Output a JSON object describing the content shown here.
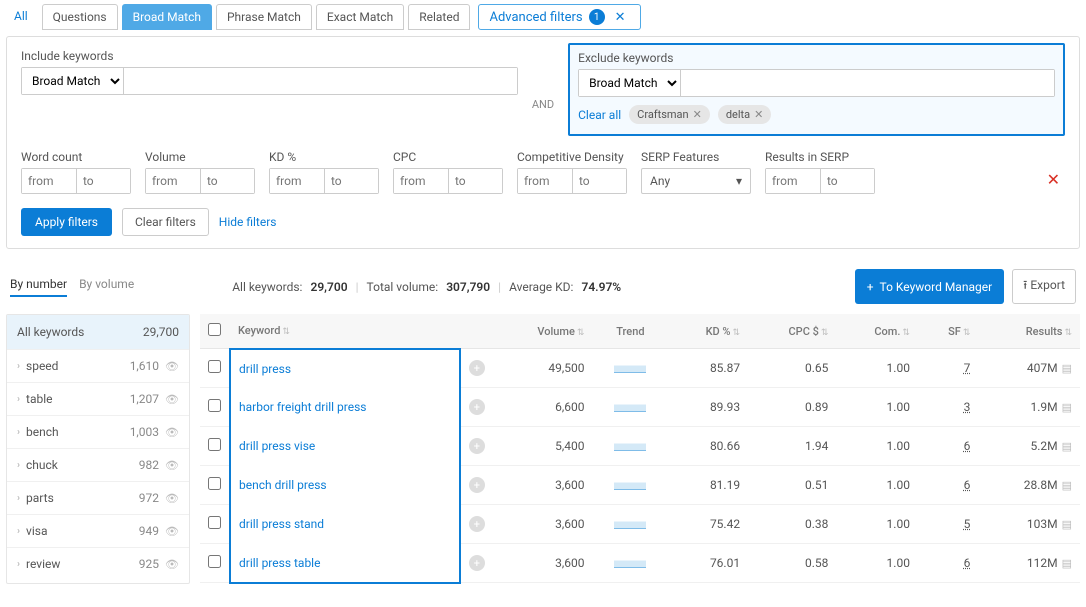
{
  "tabs": {
    "all": "All",
    "questions": "Questions",
    "broad": "Broad Match",
    "phrase": "Phrase Match",
    "exact": "Exact Match",
    "related": "Related"
  },
  "adv": {
    "label": "Advanced filters",
    "count": "1"
  },
  "include": {
    "label": "Include keywords",
    "mode": "Broad Match"
  },
  "and": "AND",
  "exclude": {
    "label": "Exclude keywords",
    "mode": "Broad Match",
    "clear": "Clear all",
    "chips": [
      "Craftsman",
      "delta"
    ]
  },
  "ranges": {
    "word": {
      "label": "Word count",
      "from": "from",
      "to": "to"
    },
    "vol": {
      "label": "Volume",
      "from": "from",
      "to": "to"
    },
    "kd": {
      "label": "KD %",
      "from": "from",
      "to": "to"
    },
    "cpc": {
      "label": "CPC",
      "from": "from",
      "to": "to"
    },
    "comp": {
      "label": "Competitive Density",
      "from": "from",
      "to": "to"
    },
    "serpf": {
      "label": "SERP Features",
      "any": "Any"
    },
    "ris": {
      "label": "Results in SERP",
      "from": "from",
      "to": "to"
    }
  },
  "actions": {
    "apply": "Apply filters",
    "clear": "Clear filters",
    "hide": "Hide filters"
  },
  "view": {
    "bynum": "By number",
    "byvol": "By volume"
  },
  "stats": {
    "allkw_l": "All keywords:",
    "allkw_v": "29,700",
    "vol_l": "Total volume:",
    "vol_v": "307,790",
    "kd_l": "Average KD:",
    "kd_v": "74.97%"
  },
  "km": {
    "btn": "To Keyword Manager",
    "export": "Export",
    "plus": "+",
    "up": "⭱"
  },
  "sidebar": {
    "head_l": "All keywords",
    "head_v": "29,700",
    "items": [
      {
        "name": "speed",
        "cnt": "1,610"
      },
      {
        "name": "table",
        "cnt": "1,207"
      },
      {
        "name": "bench",
        "cnt": "1,003"
      },
      {
        "name": "chuck",
        "cnt": "982"
      },
      {
        "name": "parts",
        "cnt": "972"
      },
      {
        "name": "visa",
        "cnt": "949"
      },
      {
        "name": "review",
        "cnt": "925"
      }
    ]
  },
  "cols": {
    "kw": "Keyword",
    "vol": "Volume",
    "trend": "Trend",
    "kd": "KD %",
    "cpc": "CPC $",
    "com": "Com.",
    "sf": "SF",
    "res": "Results"
  },
  "rows": [
    {
      "kw": "drill press",
      "vol": "49,500",
      "kd": "85.87",
      "cpc": "0.65",
      "com": "1.00",
      "sf": "7",
      "res": "407M"
    },
    {
      "kw": "harbor freight drill press",
      "vol": "6,600",
      "kd": "89.93",
      "cpc": "0.89",
      "com": "1.00",
      "sf": "3",
      "res": "1.9M"
    },
    {
      "kw": "drill press vise",
      "vol": "5,400",
      "kd": "80.66",
      "cpc": "1.94",
      "com": "1.00",
      "sf": "6",
      "res": "5.2M"
    },
    {
      "kw": "bench drill press",
      "vol": "3,600",
      "kd": "81.19",
      "cpc": "0.51",
      "com": "1.00",
      "sf": "6",
      "res": "28.8M"
    },
    {
      "kw": "drill press stand",
      "vol": "3,600",
      "kd": "75.42",
      "cpc": "0.38",
      "com": "1.00",
      "sf": "5",
      "res": "103M"
    },
    {
      "kw": "drill press table",
      "vol": "3,600",
      "kd": "76.01",
      "cpc": "0.58",
      "com": "1.00",
      "sf": "6",
      "res": "112M"
    }
  ]
}
